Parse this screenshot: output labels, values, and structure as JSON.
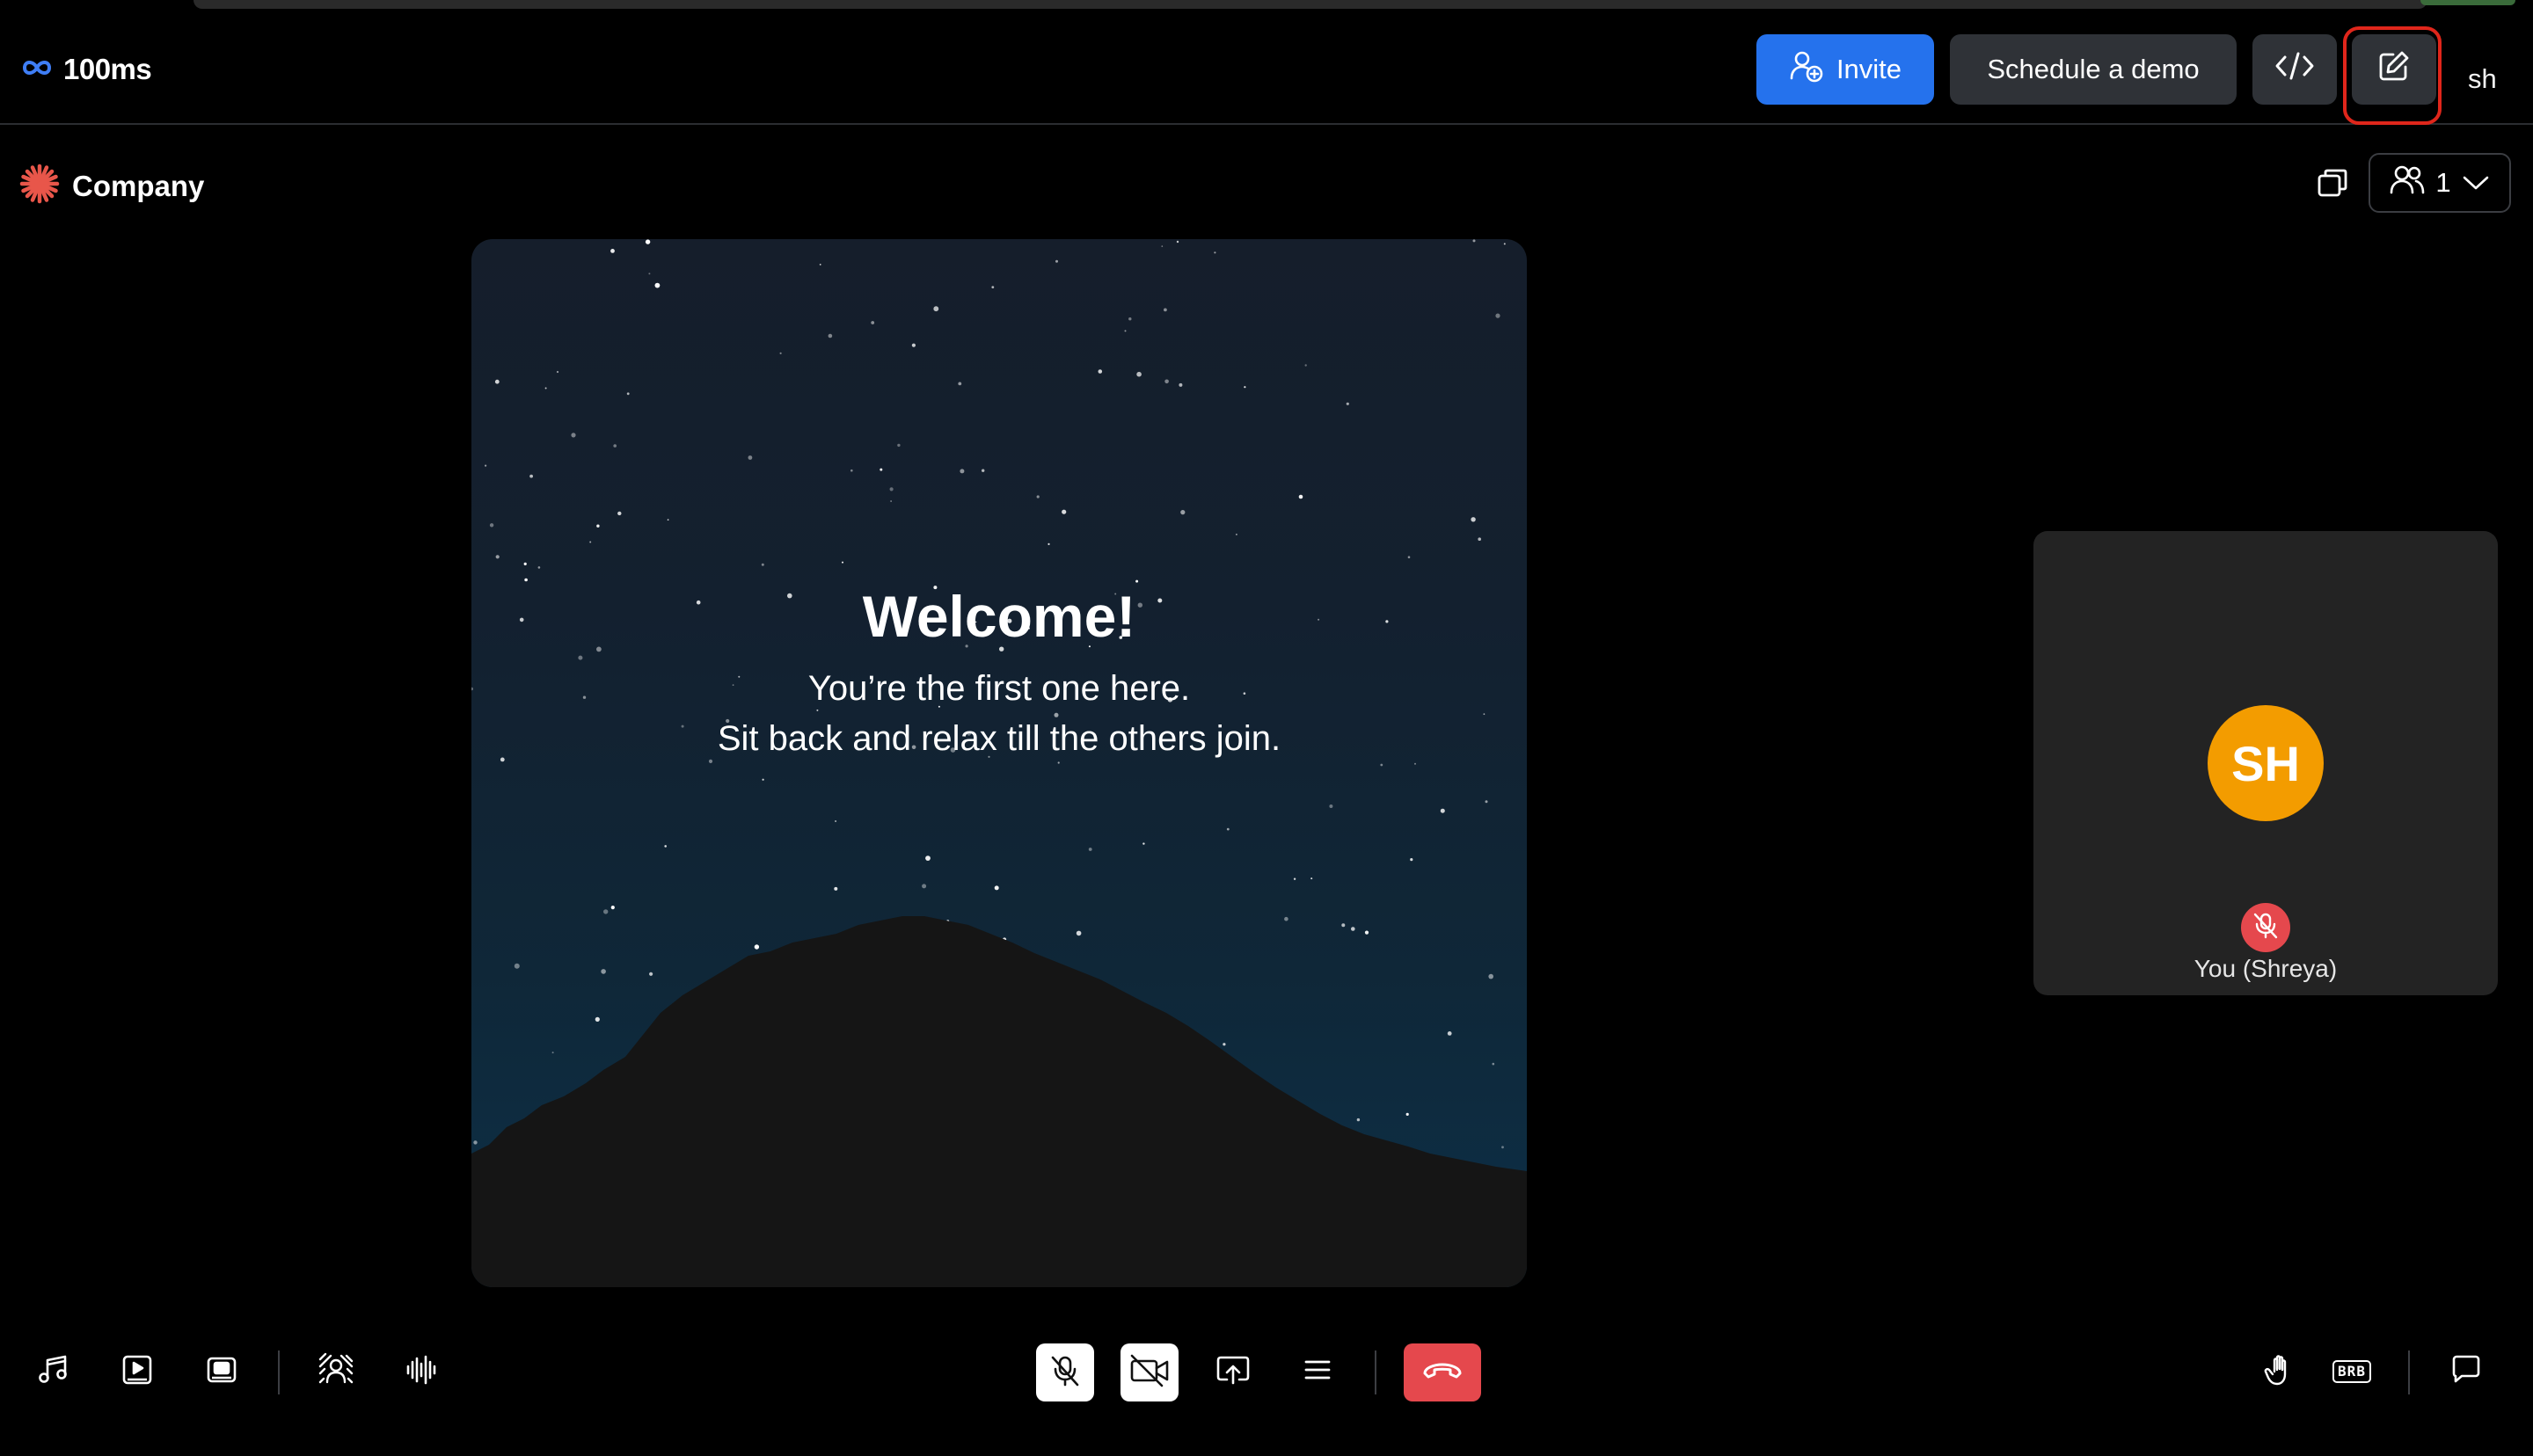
{
  "header": {
    "brand": "100ms",
    "invite_label": "Invite",
    "schedule_demo_label": "Schedule a demo",
    "user_initials": "sh",
    "icons": [
      "infinity-logo-icon",
      "add-user-icon",
      "code-icon",
      "edit-icon"
    ]
  },
  "room": {
    "company_name": "Company",
    "participants_count": "1",
    "icons": [
      "company-burst-icon",
      "pip-icon",
      "people-icon",
      "chevron-down-icon"
    ]
  },
  "welcome": {
    "title": "Welcome!",
    "line1": "You’re the first one here.",
    "line2": "Sit back and relax till the others join."
  },
  "self_tile": {
    "initials": "SH",
    "name": "You (Shreya)",
    "muted": true
  },
  "footer": {
    "left_icons": [
      "music-icon",
      "play-video-icon",
      "screen-recording-icon",
      "background-blur-icon",
      "noise-suppression-icon"
    ],
    "center_icons": [
      "mic-off-icon",
      "video-off-icon",
      "screen-share-icon",
      "menu-icon",
      "end-call-icon"
    ],
    "right_icons": [
      "raise-hand-icon",
      "brb-icon",
      "chat-icon"
    ],
    "brb_label": "BRB"
  },
  "colors": {
    "accent": "#2572ED",
    "button_dark": "#2f3237",
    "avatar": "#F39C00",
    "danger": "#e5484d",
    "highlight_ring": "#e0261b",
    "company_icon": "#e8564a"
  }
}
